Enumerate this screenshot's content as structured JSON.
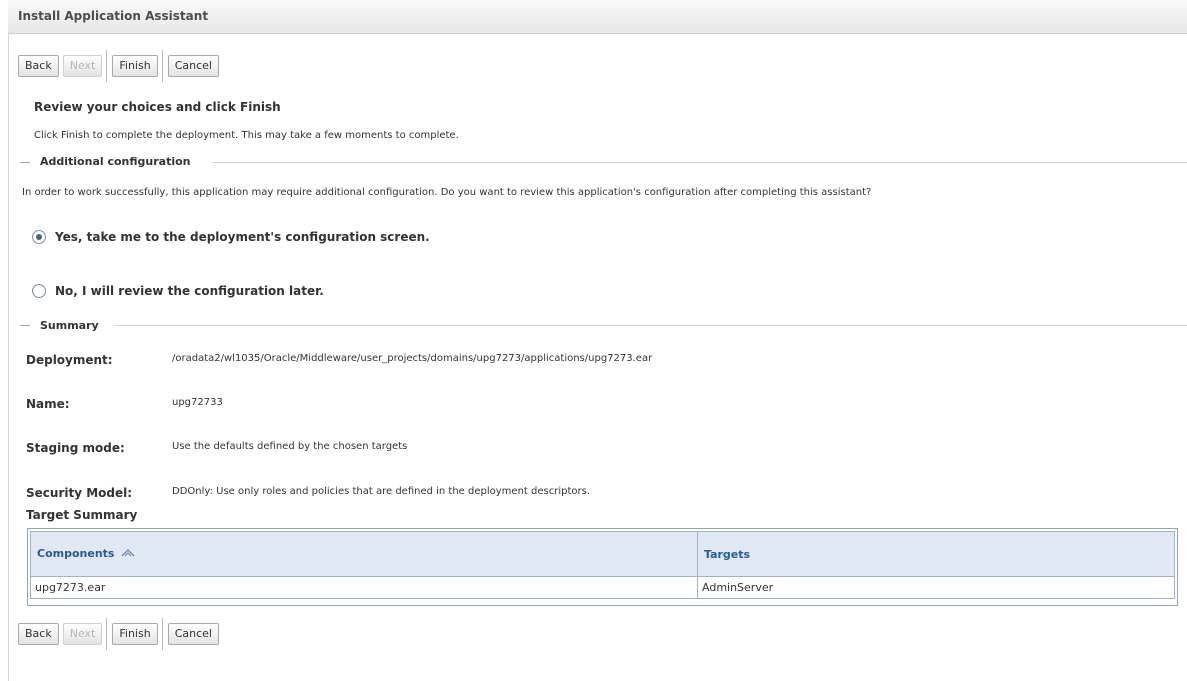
{
  "title": "Install Application Assistant",
  "buttons": {
    "back": "Back",
    "next": "Next",
    "finish": "Finish",
    "cancel": "Cancel"
  },
  "review": {
    "heading": "Review your choices and click Finish",
    "instruction": "Click Finish to complete the deployment. This may take a few moments to complete."
  },
  "additional": {
    "legend": "Additional configuration",
    "question": "In order to work successfully, this application may require additional configuration. Do you want to review this application's configuration after completing this assistant?",
    "options": [
      {
        "label": "Yes, take me to the deployment's configuration screen.",
        "selected": true
      },
      {
        "label": "No, I will review the configuration later.",
        "selected": false
      }
    ]
  },
  "summary": {
    "legend": "Summary",
    "rows": [
      {
        "label": "Deployment:",
        "value": "/oradata2/wl1035/Oracle/Middleware/user_projects/domains/upg7273/applications/upg7273.ear"
      },
      {
        "label": "Name:",
        "value": "upg72733"
      },
      {
        "label": "Staging mode:",
        "value": "Use the defaults defined by the chosen targets"
      },
      {
        "label": "Security Model:",
        "value": "DDOnly: Use only roles and policies that are defined in the deployment descriptors."
      }
    ]
  },
  "target_summary": {
    "heading": "Target Summary",
    "columns": [
      "Components",
      "Targets"
    ],
    "rows": [
      {
        "component": "upg7273.ear",
        "target": "AdminServer"
      }
    ]
  },
  "icons": {
    "sort": "sort-ascending-icon",
    "radio": "radio-button-icon"
  },
  "colors": {
    "header_text": "#2a5a93",
    "header_bg": "#dfe8f3",
    "section_line": "#c6d3e3"
  }
}
